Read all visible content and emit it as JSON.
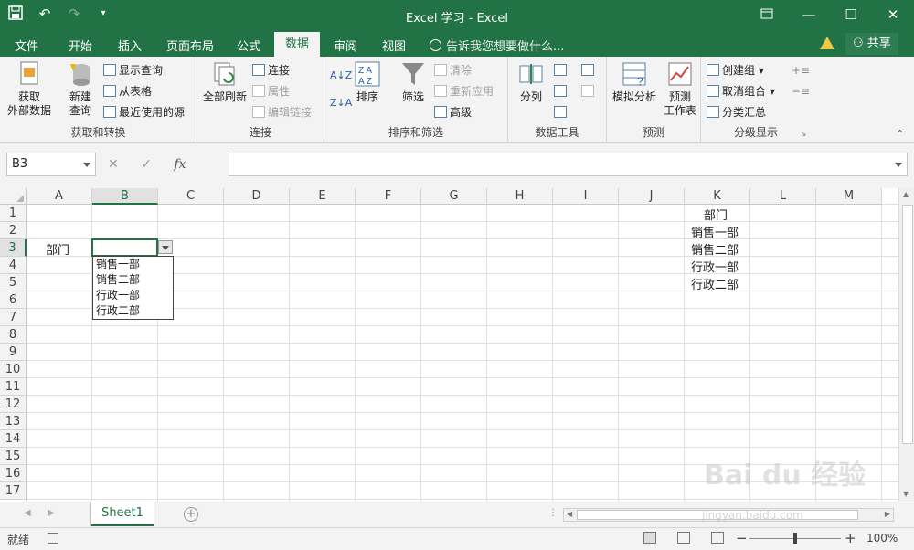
{
  "window": {
    "title": "Excel 学习 - Excel",
    "qat": {
      "save_icon": "save-icon",
      "undo_icon": "undo-icon",
      "redo_icon": "redo-icon",
      "customize_icon": "customize-qat-icon"
    },
    "controls": [
      "restore-ribbon-icon",
      "minimize-icon",
      "maximize-icon",
      "close-icon"
    ]
  },
  "tabs": [
    "文件",
    "开始",
    "插入",
    "页面布局",
    "公式",
    "数据",
    "审阅",
    "视图"
  ],
  "active_tab": "数据",
  "tell_me": "告诉我您想要做什么...",
  "share_label": "共享",
  "ribbon": {
    "get_transform": {
      "label": "获取和转换",
      "get_external": "获取\n外部数据",
      "new_query": "新建\n查询",
      "show_queries": "显示查询",
      "from_table": "从表格",
      "recent_sources": "最近使用的源"
    },
    "connections": {
      "label": "连接",
      "refresh_all": "全部刷新",
      "connections": "连接",
      "properties": "属性",
      "edit_links": "编辑链接"
    },
    "sort_filter": {
      "label": "排序和筛选",
      "sort": "排序",
      "filter": "筛选",
      "clear": "清除",
      "reapply": "重新应用",
      "advanced": "高级"
    },
    "data_tools": {
      "label": "数据工具",
      "text_to_columns": "分列"
    },
    "forecast": {
      "label": "预测",
      "what_if": "模拟分析",
      "forecast_sheet": "预测\n工作表"
    },
    "outline": {
      "label": "分级显示",
      "group": "创建组",
      "ungroup": "取消组合",
      "subtotal": "分类汇总"
    }
  },
  "formula_bar": {
    "name_box": "B3",
    "cancel": "✕",
    "enter": "✓",
    "fx": "fx",
    "content": ""
  },
  "columns": [
    "A",
    "B",
    "C",
    "D",
    "E",
    "F",
    "G",
    "H",
    "I",
    "J",
    "K",
    "L",
    "M"
  ],
  "selected_column": "B",
  "rows": [
    "1",
    "2",
    "3",
    "4",
    "5",
    "6",
    "7",
    "8",
    "9",
    "10",
    "11",
    "12",
    "13",
    "14",
    "15",
    "16",
    "17"
  ],
  "selected_row": "3",
  "cells": {
    "A3": "部门",
    "K1": "部门",
    "K2": "销售一部",
    "K3": "销售二部",
    "K4": "行政一部",
    "K5": "行政二部"
  },
  "dropdown_options": [
    "销售一部",
    "销售二部",
    "行政一部",
    "行政二部"
  ],
  "sheet_tab": "Sheet1",
  "add_sheet": "+",
  "status": {
    "ready": "就绪",
    "zoom": "100%",
    "zoom_minus": "−",
    "zoom_plus": "+"
  },
  "watermark": {
    "main": "Bai du 经验",
    "sub": "jingyan.baidu.com"
  }
}
